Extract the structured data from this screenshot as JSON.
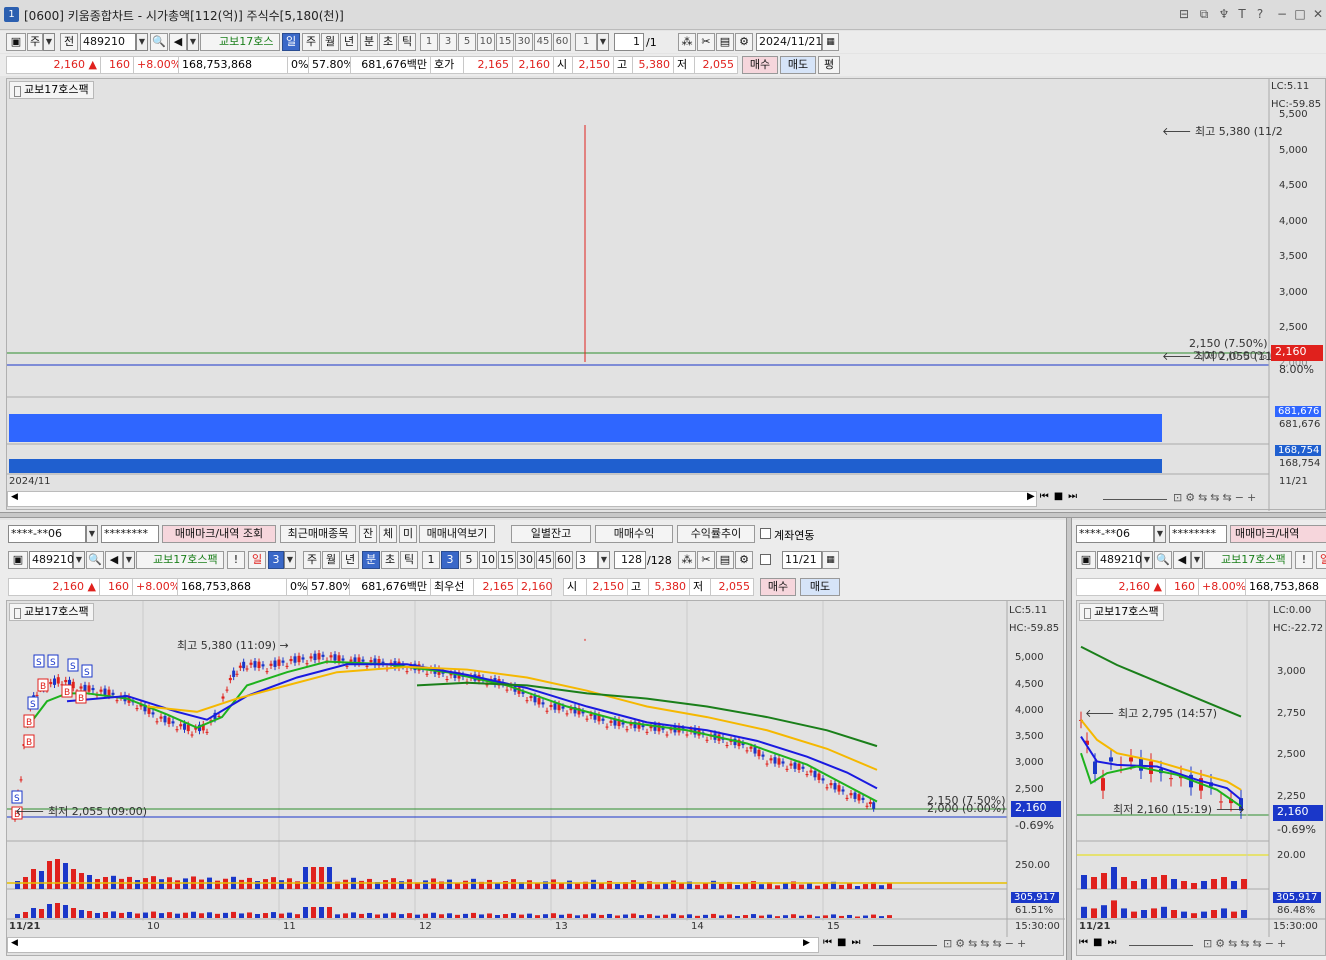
{
  "window": {
    "number": "1",
    "title": "[0600] 키움종합차트 - 시가총액[112(억)] 주식수[5,180(천)]"
  },
  "colors": {
    "up": "#e0211d",
    "down": "#1a37c9",
    "ma5": "#1db21d",
    "ma10": "#1a1ae0",
    "ma20": "#f5b800",
    "ma60": "#1a7f1a",
    "vol_up": "#e0211d",
    "vol_down": "#1a37c9",
    "bar_blue": "#2f66ff"
  },
  "top": {
    "toolbar": {
      "kind1": "주",
      "kind2": "전",
      "code": "489210",
      "name": "교보17호스",
      "period_sel": "일",
      "periods": [
        "주",
        "월",
        "년",
        "분",
        "초",
        "틱"
      ],
      "nums": [
        "1",
        "3",
        "5",
        "10",
        "15",
        "30",
        "45",
        "60"
      ],
      "count_val": "1",
      "page": "1",
      "page_total": "/1",
      "date": "2024/11/21"
    },
    "price": {
      "price": "2,160",
      "arrow": "▲",
      "change": "160",
      "rate": "+8.00%",
      "volume": "168,753,868",
      "zero": "0%",
      "ratio": "57.80%",
      "amount": "681,676백만",
      "hoga_label": "호가",
      "hoga1": "2,165",
      "hoga2": "2,160",
      "open_label": "시",
      "open": "2,150",
      "high_label": "고",
      "high": "5,380",
      "low_label": "저",
      "low": "2,055",
      "buy": "매수",
      "sell": "매도",
      "avg": "평"
    },
    "chart": {
      "label": "교보17호스팩",
      "lc": "LC:5.11",
      "hc": "HC:-59.85",
      "max_note": "최고 5,380 (11/2",
      "low_note": "최저 2,055 (11/2",
      "line_label": "2,150 (7.50%)",
      "line_label2": "2,000 (0.00%)",
      "yticks": [
        "5,500",
        "5,000",
        "4,500",
        "4,000",
        "3,500",
        "3,000",
        "2,500",
        "2,000"
      ],
      "price_tag": "2,160",
      "pct_tag": "8.00%",
      "vol1_tag": "681,676",
      "vol1_tag2": "681,676",
      "vol2_tag": "168,754",
      "vol2_tag2": "168,754",
      "date_left": "2024/11",
      "date_right": "11/21"
    }
  },
  "left": {
    "controls": {
      "account": "****-**06",
      "password": "********",
      "b1": "매매마크/내역 조회",
      "b2": "최근매매종목",
      "b3": "잔",
      "b4": "체",
      "b5": "미",
      "b6": "매매내역보기",
      "b7": "일별잔고",
      "b8": "매매수익",
      "b9": "수익률추이",
      "chk": "계좌연동"
    },
    "toolbar": {
      "code": "489210",
      "name": "교보17호스팩",
      "excl": "!",
      "period": "일",
      "pnum": "3",
      "periods": [
        "주",
        "월",
        "년",
        "분",
        "초",
        "틱"
      ],
      "period_sel": "분",
      "nums": [
        "1",
        "3",
        "5",
        "10",
        "15",
        "30",
        "45",
        "60"
      ],
      "num_sel": "3",
      "count": "3",
      "page": "128",
      "page_total": "/128",
      "date": "11/21"
    },
    "price": {
      "price": "2,160",
      "arrow": "▲",
      "change": "160",
      "rate": "+8.00%",
      "volume": "168,753,868",
      "zero": "0%",
      "ratio": "57.80%",
      "amount": "681,676백만",
      "hoga_label": "최우선",
      "hoga1": "2,165",
      "hoga2": "2,160",
      "open_label": "시",
      "open": "2,150",
      "high_label": "고",
      "high": "5,380",
      "low_label": "저",
      "low": "2,055",
      "buy": "매수",
      "sell": "매도"
    },
    "chart": {
      "label": "교보17호스팩",
      "lc": "LC:5.11",
      "hc": "HC:-59.85",
      "max_note": "최고 5,380 (11:09) →",
      "low_note": "최저 2,055 (09:00)",
      "line1": "2,150 (7.50%)",
      "line2": "2,000 (0.00%)",
      "yticks": [
        "5,000",
        "4,500",
        "4,000",
        "3,500",
        "3,000",
        "2,500"
      ],
      "price_tag": "2,160",
      "pct_tag": "-0.69%",
      "vol_tick": "250.00",
      "vol_tag": "305,917",
      "vol_pct": "61.51%",
      "xdates": [
        "11/21",
        "10",
        "11",
        "12",
        "13",
        "14",
        "15"
      ],
      "time": "15:30:00"
    }
  },
  "right": {
    "controls": {
      "account": "****-**06",
      "password": "********",
      "b1": "매매마크/내역"
    },
    "toolbar": {
      "code": "489210",
      "name": "교보17호스팩",
      "excl": "!",
      "period": "일"
    },
    "price": {
      "price": "2,160",
      "arrow": "▲",
      "change": "160",
      "rate": "+8.00%",
      "volume": "168,753,868"
    },
    "chart": {
      "label": "교보17호스팩",
      "lc": "LC:0.00",
      "hc": "HC:-22.72",
      "max_note": "최고 2,795 (14:57)",
      "low_note": "최저 2,160 (15:19)",
      "yticks": [
        "3,000",
        "2,750",
        "2,500",
        "2,250"
      ],
      "price_tag": "2,160",
      "pct_tag": "-0.69%",
      "vol_tick": "20.00",
      "vol_tag": "305,917",
      "vol_pct": "86.48%",
      "xdate": "11/21",
      "time": "15:30:00"
    }
  }
}
